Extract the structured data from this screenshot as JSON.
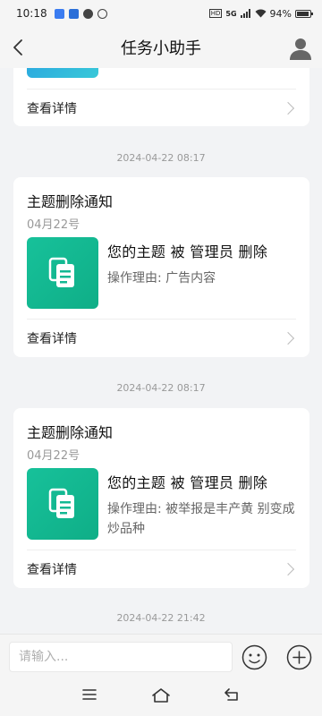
{
  "status_bar": {
    "time": "10:18",
    "network": "5G",
    "battery": "94%"
  },
  "header": {
    "title": "任务小助手"
  },
  "feed": {
    "partial_card": {
      "detail_label": "查看详情"
    },
    "items": [
      {
        "timestamp": "2024-04-22 08:17",
        "card_title": "主题删除通知",
        "card_date": "04月22号",
        "message_title": "您的主题 被 管理员 删除",
        "message_reason": "操作理由: 广告内容",
        "detail_label": "查看详情"
      },
      {
        "timestamp": "2024-04-22 08:17",
        "card_title": "主题删除通知",
        "card_date": "04月22号",
        "message_title": "您的主题 被 管理员 删除",
        "message_reason": "操作理由: 被举报是丰产黄 别变成炒品种",
        "detail_label": "查看详情"
      }
    ],
    "last_timestamp": "2024-04-22 21:42"
  },
  "input_bar": {
    "placeholder": "请输入..."
  },
  "colors": {
    "accent": "#13b893",
    "background": "#f2f3f5"
  }
}
